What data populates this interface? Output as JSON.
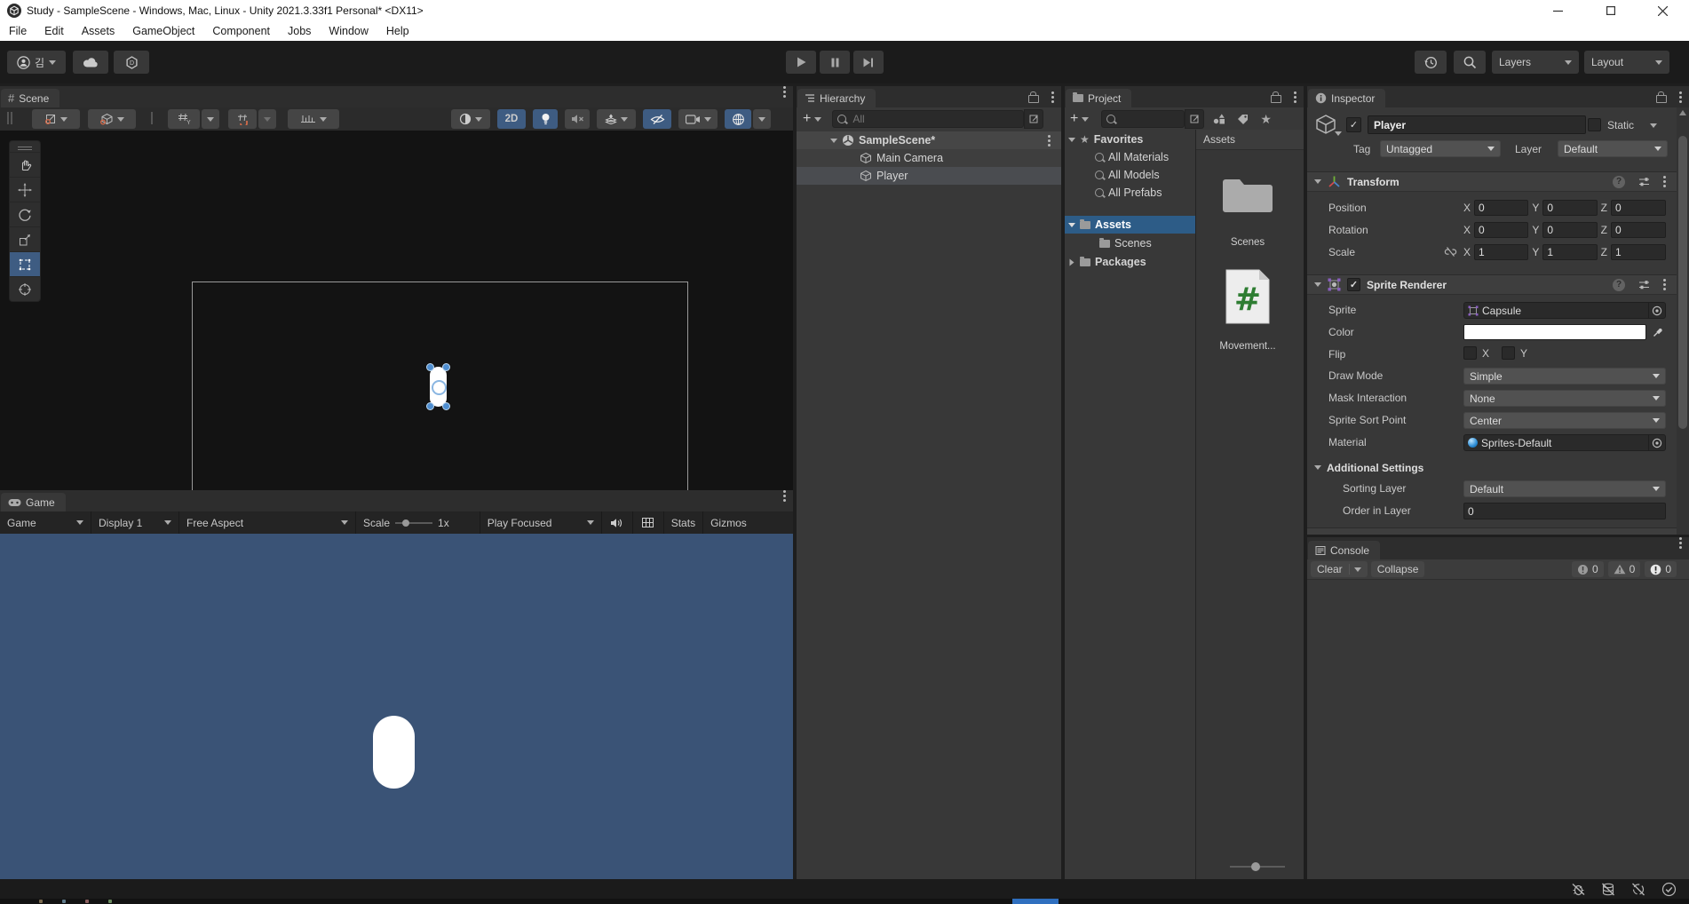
{
  "window": {
    "title": "Study - SampleScene - Windows, Mac, Linux - Unity 2021.3.33f1 Personal* <DX11>"
  },
  "menu": {
    "items": [
      "File",
      "Edit",
      "Assets",
      "GameObject",
      "Component",
      "Jobs",
      "Window",
      "Help"
    ]
  },
  "toolbar": {
    "account": "김",
    "layers": "Layers",
    "layout": "Layout"
  },
  "scene": {
    "tab": "Scene",
    "mode_2d": "2D"
  },
  "game": {
    "tab": "Game",
    "target": "Game",
    "display": "Display 1",
    "aspect": "Free Aspect",
    "scale_label": "Scale",
    "scale_value": "1x",
    "focus_mode": "Play Focused",
    "stats": "Stats",
    "gizmos": "Gizmos"
  },
  "hierarchy": {
    "tab": "Hierarchy",
    "search_placeholder": "All",
    "scene_name": "SampleScene*",
    "items": [
      {
        "label": "Main Camera"
      },
      {
        "label": "Player"
      }
    ]
  },
  "project": {
    "tab": "Project",
    "favorites": "Favorites",
    "favorite_items": [
      "All Materials",
      "All Models",
      "All Prefabs"
    ],
    "assets": "Assets",
    "scenes": "Scenes",
    "packages": "Packages",
    "pane_title": "Assets",
    "tiles": [
      {
        "label": "Scenes"
      },
      {
        "label": "Movement..."
      }
    ]
  },
  "inspector": {
    "tab": "Inspector",
    "object_name": "Player",
    "static_label": "Static",
    "tag_label": "Tag",
    "tag_value": "Untagged",
    "layer_label": "Layer",
    "layer_value": "Default",
    "axis": {
      "x": "X",
      "y": "Y",
      "z": "Z"
    },
    "transform": {
      "title": "Transform",
      "position_label": "Position",
      "rotation_label": "Rotation",
      "scale_label": "Scale",
      "position": {
        "x": "0",
        "y": "0",
        "z": "0"
      },
      "rotation": {
        "x": "0",
        "y": "0",
        "z": "0"
      },
      "scale": {
        "x": "1",
        "y": "1",
        "z": "1"
      }
    },
    "sprite_renderer": {
      "title": "Sprite Renderer",
      "sprite_label": "Sprite",
      "sprite_value": "Capsule",
      "color_label": "Color",
      "flip_label": "Flip",
      "draw_mode_label": "Draw Mode",
      "draw_mode_value": "Simple",
      "mask_label": "Mask Interaction",
      "mask_value": "None",
      "sort_point_label": "Sprite Sort Point",
      "sort_point_value": "Center",
      "material_label": "Material",
      "material_value": "Sprites-Default",
      "additional_label": "Additional Settings",
      "sorting_layer_label": "Sorting Layer",
      "sorting_layer_value": "Default",
      "order_label": "Order in Layer",
      "order_value": "0"
    }
  },
  "console": {
    "tab": "Console",
    "clear": "Clear",
    "collapse": "Collapse",
    "info_count": "0",
    "warning_count": "0",
    "error_count": "0"
  },
  "colors": {
    "selection_blue": "#2d5c87",
    "toggle_blue": "#3e5c82",
    "game_background": "#3a5376",
    "script_green": "#2e7d32"
  }
}
